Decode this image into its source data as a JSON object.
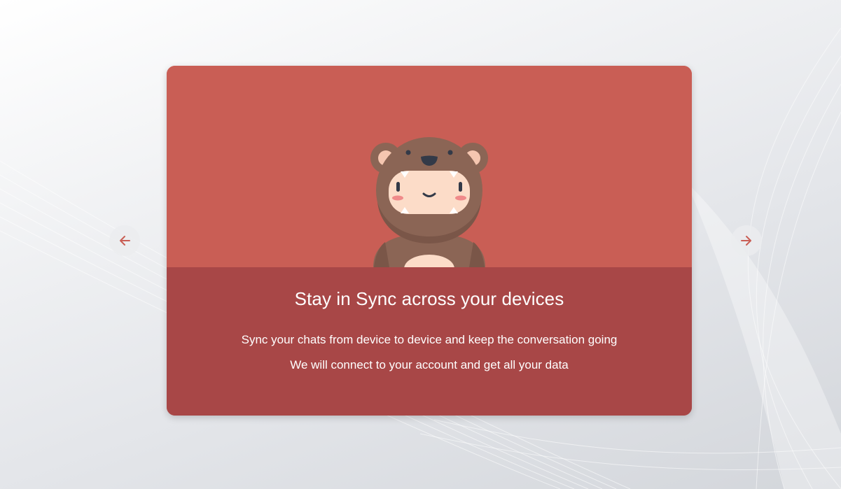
{
  "slide": {
    "title": "Stay in Sync across your devices",
    "description_1": "Sync your chats from device to device and keep the conversation going",
    "description_2": "We will connect to your account and get all your data",
    "illustration": "bear-costume-character"
  },
  "navigation": {
    "prev_icon": "arrow-left-icon",
    "next_icon": "arrow-right-icon"
  },
  "colors": {
    "card_top": "#c95e55",
    "card_bottom": "#a84747",
    "arrow": "#c95e55",
    "bear_fur": "#8b6555",
    "face": "#fcdcc8"
  }
}
